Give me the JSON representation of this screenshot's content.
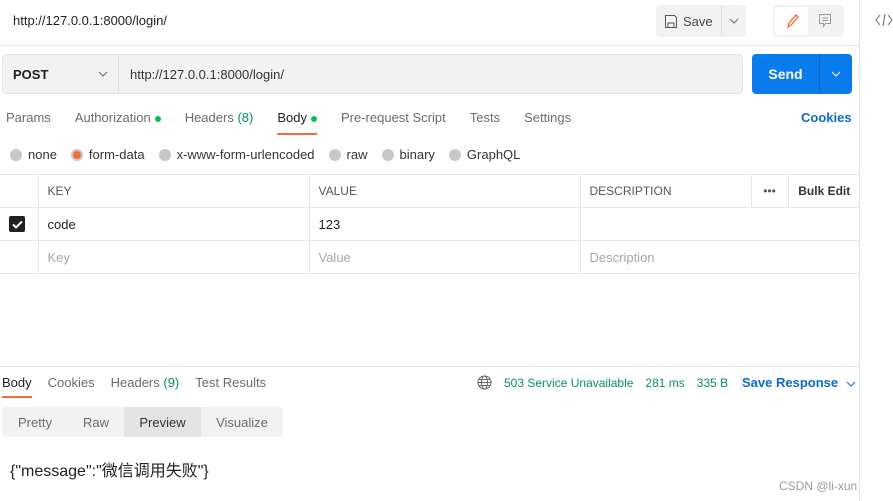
{
  "header": {
    "title": "http://127.0.0.1:8000/login/",
    "save_label": "Save"
  },
  "request": {
    "method": "POST",
    "url": "http://127.0.0.1:8000/login/",
    "send_label": "Send"
  },
  "tabs": [
    {
      "label": "Params"
    },
    {
      "label": "Authorization",
      "dot": true
    },
    {
      "label": "Headers",
      "count": "(8)"
    },
    {
      "label": "Body",
      "dot": true,
      "active": true
    },
    {
      "label": "Pre-request Script"
    },
    {
      "label": "Tests"
    },
    {
      "label": "Settings"
    }
  ],
  "cookies_label": "Cookies",
  "body_types": [
    {
      "label": "none"
    },
    {
      "label": "form-data",
      "selected": true
    },
    {
      "label": "x-www-form-urlencoded"
    },
    {
      "label": "raw"
    },
    {
      "label": "binary"
    },
    {
      "label": "GraphQL"
    }
  ],
  "table": {
    "headers": [
      "KEY",
      "VALUE",
      "DESCRIPTION"
    ],
    "more": "•••",
    "bulk_edit": "Bulk Edit",
    "rows": [
      {
        "checked": true,
        "key": "code",
        "value": "123",
        "description": ""
      }
    ],
    "placeholders": {
      "key": "Key",
      "value": "Value",
      "description": "Description"
    }
  },
  "response": {
    "tabs": [
      {
        "label": "Body",
        "active": true
      },
      {
        "label": "Cookies"
      },
      {
        "label": "Headers",
        "count": "(9)"
      },
      {
        "label": "Test Results"
      }
    ],
    "status": "503 Service Unavailable",
    "time": "281 ms",
    "size": "335 B",
    "save_label": "Save Response",
    "view_tabs": [
      "Pretty",
      "Raw",
      "Preview",
      "Visualize"
    ],
    "active_view": "Preview",
    "body": "{\"message\":\"微信调用失败\"}"
  },
  "watermark": "CSDN @li-xun",
  "colors": {
    "accent": "#f26b3a",
    "send": "#097bed",
    "status": "#0a8f63",
    "link": "#0b6bcb"
  }
}
